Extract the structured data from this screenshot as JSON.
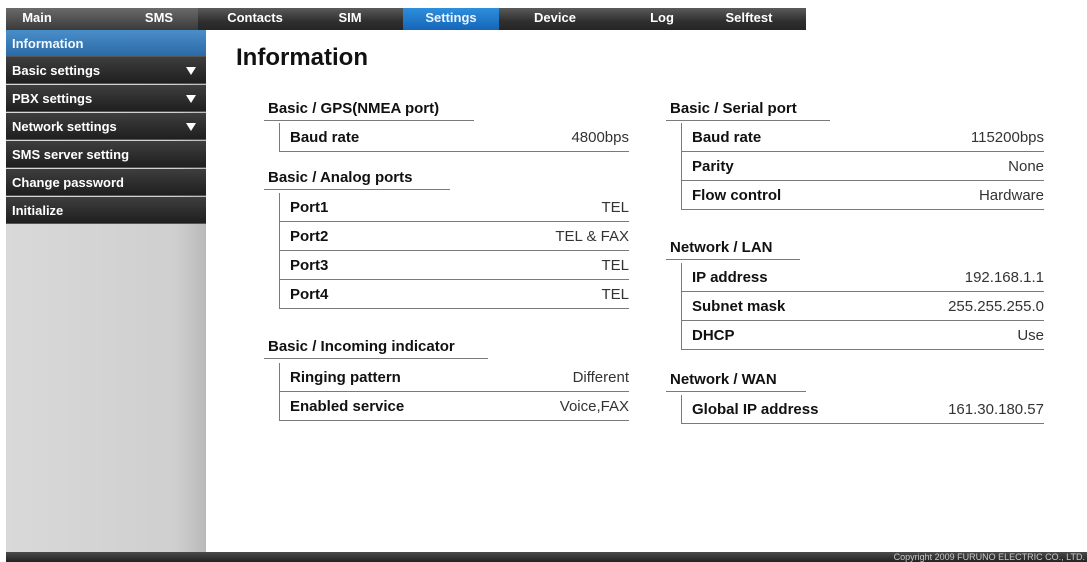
{
  "topnav": {
    "tabs": [
      {
        "label": "Main"
      },
      {
        "label": "SMS"
      },
      {
        "label": "Contacts"
      },
      {
        "label": "SIM"
      },
      {
        "label": "Settings"
      },
      {
        "label": "Device"
      },
      {
        "label": "Log"
      },
      {
        "label": "Selftest"
      }
    ],
    "active": "Settings"
  },
  "sidebar": {
    "items": [
      {
        "label": "Information",
        "active": true
      },
      {
        "label": "Basic settings",
        "has_arrow": true
      },
      {
        "label": "PBX settings",
        "has_arrow": true
      },
      {
        "label": "Network settings",
        "has_arrow": true
      },
      {
        "label": "SMS server setting"
      },
      {
        "label": "Change password"
      },
      {
        "label": "Initialize"
      }
    ]
  },
  "page": {
    "title": "Information"
  },
  "sections": {
    "gps": {
      "title": "Basic / GPS(NMEA port)",
      "rows": [
        {
          "label": "Baud rate",
          "value": "4800bps"
        }
      ]
    },
    "analog": {
      "title": "Basic / Analog ports",
      "rows": [
        {
          "label": "Port1",
          "value": "TEL"
        },
        {
          "label": "Port2",
          "value": "TEL & FAX"
        },
        {
          "label": "Port3",
          "value": "TEL"
        },
        {
          "label": "Port4",
          "value": "TEL"
        }
      ]
    },
    "incoming": {
      "title": "Basic / Incoming indicator",
      "rows": [
        {
          "label": "Ringing pattern",
          "value": "Different"
        },
        {
          "label": "Enabled service",
          "value": "Voice,FAX"
        }
      ]
    },
    "serial": {
      "title": "Basic / Serial port",
      "rows": [
        {
          "label": "Baud rate",
          "value": "115200bps"
        },
        {
          "label": "Parity",
          "value": "None"
        },
        {
          "label": "Flow control",
          "value": "Hardware"
        }
      ]
    },
    "lan": {
      "title": "Network / LAN",
      "rows": [
        {
          "label": "IP address",
          "value": "192.168.1.1"
        },
        {
          "label": "Subnet mask",
          "value": "255.255.255.0"
        },
        {
          "label": "DHCP",
          "value": "Use"
        }
      ]
    },
    "wan": {
      "title": "Network / WAN",
      "rows": [
        {
          "label": "Global IP address",
          "value": "161.30.180.57"
        }
      ]
    }
  },
  "footer": {
    "copyright": "Copyright 2009 FURUNO ELECTRIC CO., LTD."
  },
  "colors": {
    "active_tab": "#1e75c8",
    "active_sidebar": "#3a7dbc",
    "sidebar_item": "#2b2b2b"
  }
}
